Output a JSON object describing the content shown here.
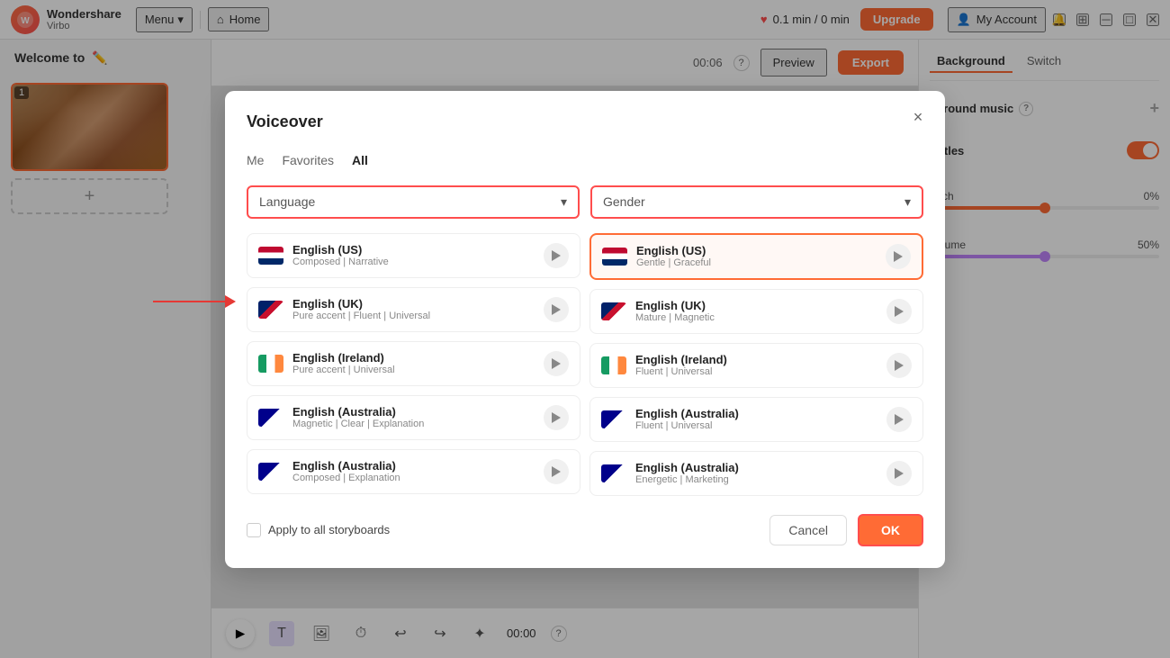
{
  "app": {
    "logo_name": "Wondershare",
    "logo_product": "Virbo",
    "menu_label": "Menu",
    "home_label": "Home",
    "time_display": "0.1 min / 0 min",
    "upgrade_label": "Upgrade",
    "account_label": "My Account",
    "time_code": "00:06",
    "preview_label": "Preview",
    "export_label": "Export",
    "bottom_time": "00:00"
  },
  "sidebar": {
    "title": "Welcome to",
    "slide_number": "1",
    "add_label": "+"
  },
  "right_panel": {
    "tabs": [
      "Background",
      "Switch"
    ],
    "bg_music_label": "kground music",
    "subtitles_label": "btitles",
    "pitch_label": "Pitch",
    "pitch_value": "0%",
    "volume_label": "Volume",
    "volume_value": "50%"
  },
  "dialog": {
    "title": "Voiceover",
    "close_label": "×",
    "tabs": [
      {
        "label": "Me",
        "active": false
      },
      {
        "label": "Favorites",
        "active": false
      },
      {
        "label": "All",
        "active": true
      }
    ],
    "language_placeholder": "Language",
    "gender_placeholder": "Gender",
    "voices_left": [
      {
        "id": "en-us-1",
        "name": "English (US)",
        "desc": "Composed | Narrative",
        "flag": "us",
        "selected": false
      },
      {
        "id": "en-uk-1",
        "name": "English (UK)",
        "desc": "Pure accent | Fluent | Universal",
        "flag": "uk",
        "selected": false
      },
      {
        "id": "en-ie-1",
        "name": "English (Ireland)",
        "desc": "Pure accent | Universal",
        "flag": "ireland",
        "selected": false
      },
      {
        "id": "en-au-1",
        "name": "English (Australia)",
        "desc": "Magnetic | Clear | Explanation",
        "flag": "aus",
        "selected": false
      },
      {
        "id": "en-au-3",
        "name": "English (Australia)",
        "desc": "Composed | Explanation",
        "flag": "aus",
        "selected": false
      }
    ],
    "voices_right": [
      {
        "id": "en-us-2",
        "name": "English (US)",
        "desc": "Gentle | Graceful",
        "flag": "us",
        "selected": true
      },
      {
        "id": "en-uk-2",
        "name": "English (UK)",
        "desc": "Mature | Magnetic",
        "flag": "uk",
        "selected": false
      },
      {
        "id": "en-ie-2",
        "name": "English (Ireland)",
        "desc": "Fluent | Universal",
        "flag": "ireland",
        "selected": false
      },
      {
        "id": "en-au-2",
        "name": "English (Australia)",
        "desc": "Fluent | Universal",
        "flag": "aus",
        "selected": false
      },
      {
        "id": "en-au-4",
        "name": "English (Australia)",
        "desc": "Energetic | Marketing",
        "flag": "aus",
        "selected": false
      }
    ],
    "apply_all_label": "Apply to all storyboards",
    "cancel_label": "Cancel",
    "ok_label": "OK"
  }
}
